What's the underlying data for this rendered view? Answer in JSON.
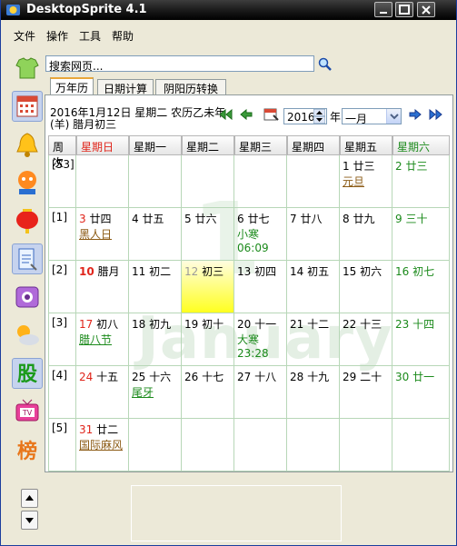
{
  "window": {
    "title": "DesktopSprite 4.1"
  },
  "menu": [
    "文件",
    "操作",
    "工具",
    "帮助"
  ],
  "search": {
    "value": "搜索网页..."
  },
  "sidebar_icons": [
    "shirt-icon",
    "calendar-icon",
    "bell-icon",
    "contact-icon",
    "lantern-icon",
    "notes-icon",
    "phone-icon",
    "weather-icon",
    "stock-icon",
    "tv-icon",
    "ranking-icon"
  ],
  "ranking_glyph": "榜",
  "tabs": [
    "万年历",
    "日期计算",
    "阴阳历转换"
  ],
  "info": {
    "line1": "2016年1月12日 星期二 农历乙未年",
    "line2": "(羊) 腊月初三"
  },
  "year": "2016",
  "year_label": "年",
  "month": "一月",
  "watermark": {
    "number": "1",
    "month": "January"
  },
  "headers": [
    "周次",
    "星期日",
    "星期一",
    "星期二",
    "星期三",
    "星期四",
    "星期五",
    "星期六"
  ],
  "weeks": [
    {
      "label": "[53]",
      "days": [
        {},
        {},
        {},
        {},
        {},
        {
          "d": "1",
          "l": "廿三",
          "f": "元旦",
          "ft": "brown"
        },
        {
          "d": "2",
          "l": "廿三",
          "c": "green"
        }
      ]
    },
    {
      "label": "[1]",
      "days": [
        {
          "d": "3",
          "l": "廿四",
          "c": "red",
          "f": "黑人日",
          "ft": "brown"
        },
        {
          "d": "4",
          "l": "廿五"
        },
        {
          "d": "5",
          "l": "廿六"
        },
        {
          "d": "6",
          "l": "廿七",
          "t": "小寒",
          "tt": "06:09"
        },
        {
          "d": "7",
          "l": "廿八"
        },
        {
          "d": "8",
          "l": "廿九"
        },
        {
          "d": "9",
          "l": "三十",
          "c": "green"
        }
      ]
    },
    {
      "label": "[2]",
      "days": [
        {
          "d": "10",
          "l": "腊月",
          "c": "red",
          "b": true
        },
        {
          "d": "11",
          "l": "初二"
        },
        {
          "d": "12",
          "l": "初三",
          "today": true
        },
        {
          "d": "13",
          "l": "初四"
        },
        {
          "d": "14",
          "l": "初五"
        },
        {
          "d": "15",
          "l": "初六"
        },
        {
          "d": "16",
          "l": "初七",
          "c": "green"
        }
      ]
    },
    {
      "label": "[3]",
      "days": [
        {
          "d": "17",
          "l": "初八",
          "c": "red",
          "f": "腊八节",
          "ft": "green"
        },
        {
          "d": "18",
          "l": "初九"
        },
        {
          "d": "19",
          "l": "初十"
        },
        {
          "d": "20",
          "l": "十一",
          "t": "大寒",
          "tt": "23:28"
        },
        {
          "d": "21",
          "l": "十二"
        },
        {
          "d": "22",
          "l": "十三"
        },
        {
          "d": "23",
          "l": "十四",
          "c": "green"
        }
      ]
    },
    {
      "label": "[4]",
      "days": [
        {
          "d": "24",
          "l": "十五",
          "c": "red"
        },
        {
          "d": "25",
          "l": "十六",
          "f": "尾牙",
          "ft": "green"
        },
        {
          "d": "26",
          "l": "十七"
        },
        {
          "d": "27",
          "l": "十八"
        },
        {
          "d": "28",
          "l": "十九"
        },
        {
          "d": "29",
          "l": "二十"
        },
        {
          "d": "30",
          "l": "廿一",
          "c": "green"
        }
      ]
    },
    {
      "label": "[5]",
      "days": [
        {
          "d": "31",
          "l": "廿二",
          "c": "red",
          "f": "国际麻风",
          "ft": "brown"
        },
        {},
        {},
        {},
        {},
        {},
        {}
      ]
    }
  ]
}
